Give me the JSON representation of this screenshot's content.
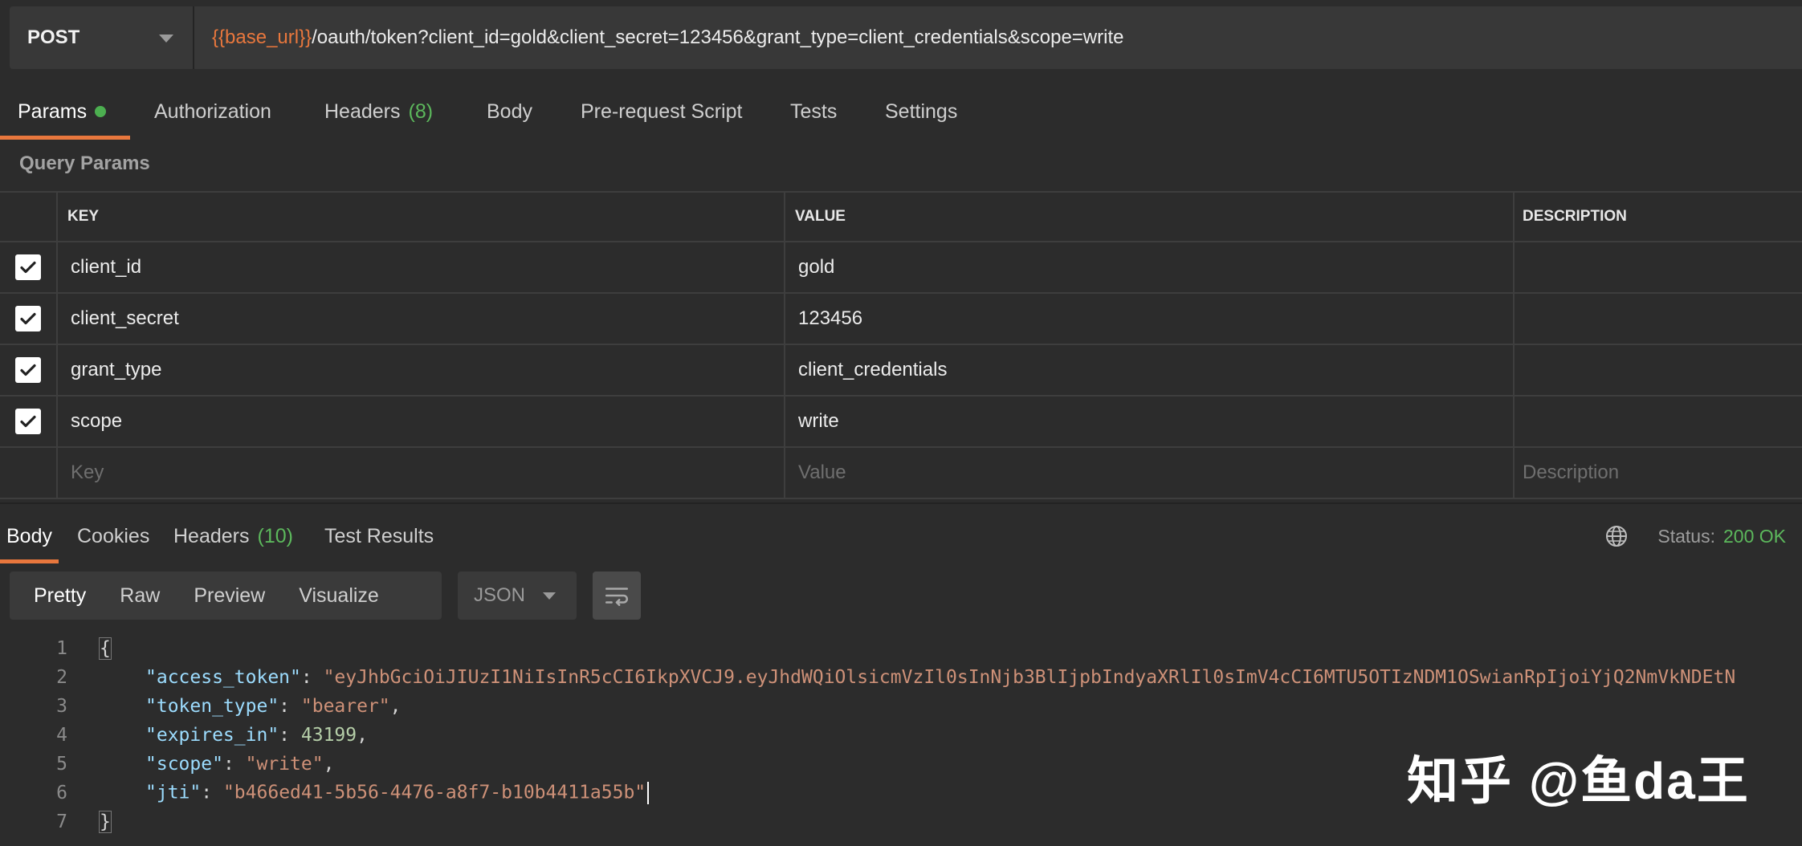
{
  "request": {
    "method": "POST",
    "url_var": "{{base_url}}",
    "url_path": "/oauth/token?client_id=gold&client_secret=123456&grant_type=client_credentials&scope=write"
  },
  "request_tabs": {
    "params": "Params",
    "authorization": "Authorization",
    "headers": "Headers",
    "headers_count": "(8)",
    "body": "Body",
    "prerequest": "Pre-request Script",
    "tests": "Tests",
    "settings": "Settings"
  },
  "query_params": {
    "title": "Query Params",
    "columns": {
      "key": "KEY",
      "value": "VALUE",
      "description": "DESCRIPTION"
    },
    "rows": [
      {
        "key": "client_id",
        "value": "gold",
        "checked": true
      },
      {
        "key": "client_secret",
        "value": "123456",
        "checked": true
      },
      {
        "key": "grant_type",
        "value": "client_credentials",
        "checked": true
      },
      {
        "key": "scope",
        "value": "write",
        "checked": true
      }
    ],
    "placeholders": {
      "key": "Key",
      "value": "Value",
      "description": "Description"
    }
  },
  "response_tabs": {
    "body": "Body",
    "cookies": "Cookies",
    "headers": "Headers",
    "headers_count": "(10)",
    "test_results": "Test Results"
  },
  "status": {
    "label": "Status:",
    "value": "200 OK"
  },
  "view_modes": {
    "pretty": "Pretty",
    "raw": "Raw",
    "preview": "Preview",
    "visualize": "Visualize"
  },
  "format": {
    "selected": "JSON"
  },
  "code": {
    "line_numbers": [
      "1",
      "2",
      "3",
      "4",
      "5",
      "6",
      "7"
    ],
    "open_brace": "{",
    "close_brace": "}",
    "access_token_key": "\"access_token\"",
    "access_token_value": "\"eyJhbGciOiJIUzI1NiIsInR5cCI6IkpXVCJ9.eyJhdWQiOlsicmVzIl0sInNjb3BlIjpbIndyaXRlIl0sImV4cCI6MTU5OTIzNDM1OSwianRpIjoiYjQ2NmVkNDEtN",
    "token_type_key": "\"token_type\"",
    "token_type_value": "\"bearer\"",
    "expires_in_key": "\"expires_in\"",
    "expires_in_value": "43199",
    "scope_key": "\"scope\"",
    "scope_value": "\"write\"",
    "jti_key": "\"jti\"",
    "jti_value": "\"b466ed41-5b56-4476-a8f7-b10b4411a55b\""
  },
  "watermark": "知乎 @鱼da王",
  "colors": {
    "accent": "#e8773d",
    "success": "#5cb85c",
    "background": "#2c2c2c"
  }
}
